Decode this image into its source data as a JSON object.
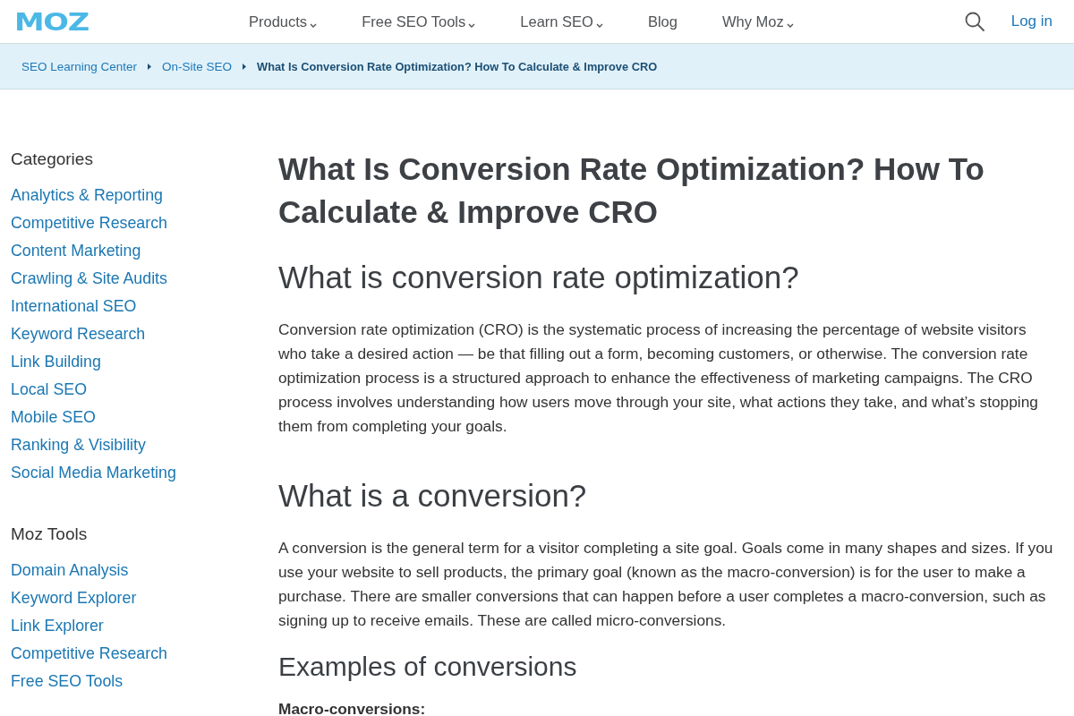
{
  "header": {
    "logo": "MOZ",
    "nav": [
      {
        "label": "Products",
        "dropdown": true
      },
      {
        "label": "Free SEO Tools",
        "dropdown": true
      },
      {
        "label": "Learn SEO",
        "dropdown": true
      },
      {
        "label": "Blog",
        "dropdown": false
      },
      {
        "label": "Why Moz",
        "dropdown": true
      }
    ],
    "login": "Log in"
  },
  "breadcrumb": [
    {
      "label": "SEO Learning Center",
      "current": false
    },
    {
      "label": "On-Site SEO",
      "current": false
    },
    {
      "label": "What Is Conversion Rate Optimization? How To Calculate & Improve CRO",
      "current": true
    }
  ],
  "sidebar": {
    "sections": [
      {
        "title": "Categories",
        "items": [
          "Analytics & Reporting",
          "Competitive Research",
          "Content Marketing",
          "Crawling & Site Audits",
          "International SEO",
          "Keyword Research",
          "Link Building",
          "Local SEO",
          "Mobile SEO",
          "Ranking & Visibility",
          "Social Media Marketing"
        ]
      },
      {
        "title": "Moz Tools",
        "items": [
          "Domain Analysis",
          "Keyword Explorer",
          "Link Explorer",
          "Competitive Research",
          "Free SEO Tools"
        ]
      }
    ]
  },
  "article": {
    "title": "What Is Conversion Rate Optimization? How To Calculate & Improve CRO",
    "blocks": [
      {
        "kind": "h2",
        "text": "What is conversion rate optimization?"
      },
      {
        "kind": "paragraph",
        "text": "Conversion rate optimization (CRO) is the systematic process of increasing the percentage of website visitors who take a desired action — be that filling out a form, becoming customers, or otherwise. The conversion rate optimization process is a structured approach to enhance the effectiveness of marketing campaigns. The CRO process involves understanding how users move through your site, what actions they take, and what’s stopping them from completing your goals."
      },
      {
        "kind": "h2",
        "text": "What is a conversion?"
      },
      {
        "kind": "paragraph",
        "text": "A conversion is the general term for a visitor completing a site goal. Goals come in many shapes and sizes. If you use your website to sell products, the primary goal (known as the macro-conversion) is for the user to make a purchase. There are smaller conversions that can happen before a user completes a macro-conversion, such as signing up to receive emails. These are called micro-conversions."
      },
      {
        "kind": "h3",
        "text": "Examples of conversions"
      },
      {
        "kind": "label",
        "text": "Macro-conversions:"
      }
    ]
  }
}
